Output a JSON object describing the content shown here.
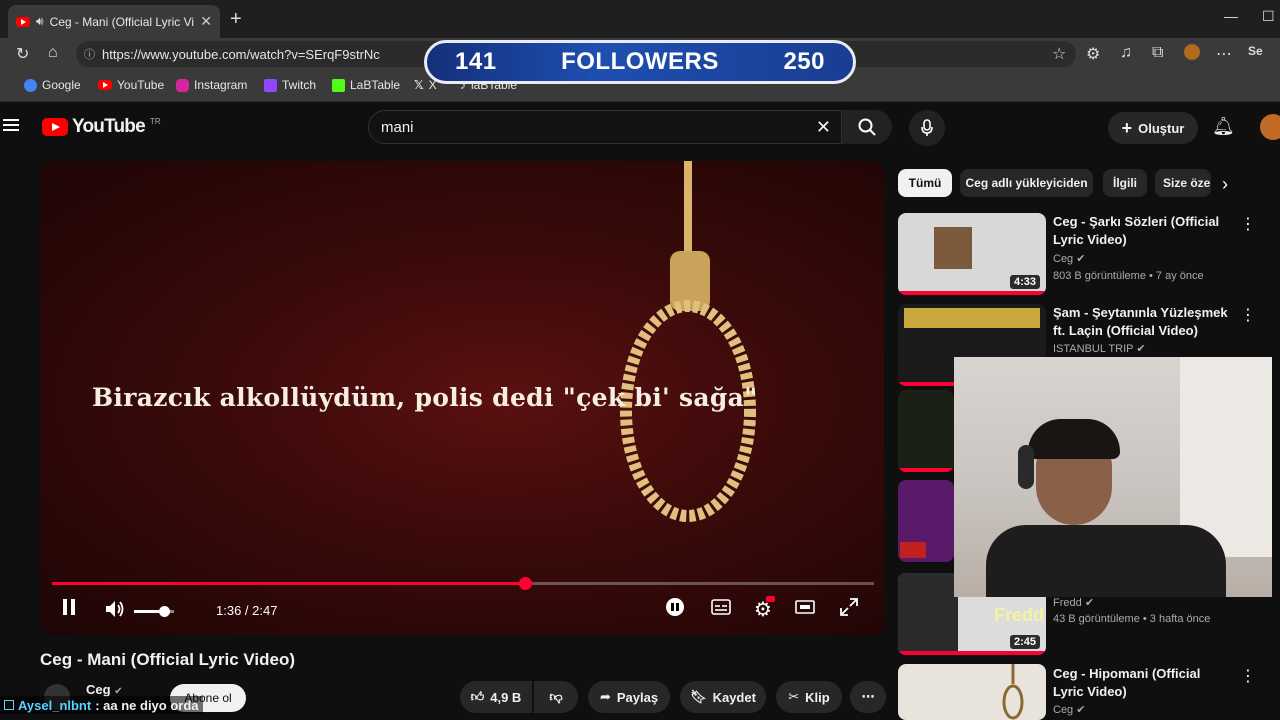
{
  "browser": {
    "tab_title": "Ceg - Mani (Official Lyric Video)",
    "new_tab": "+",
    "url": "https://www.youtube.com/watch?v=SErqF9strNc",
    "bookmarks": [
      "Google",
      "YouTube",
      "Instagram",
      "Twitch",
      "LaBTable",
      "X",
      "laBTable"
    ],
    "profile_label": "Se"
  },
  "overlay": {
    "followers_current": "141",
    "followers_label": "FOLLOWERS",
    "followers_goal": "250"
  },
  "yt": {
    "logo_text": "YouTube",
    "logo_region": "TR",
    "search_value": "mani",
    "create_label": "Oluştur"
  },
  "player": {
    "lyric": "Birazcık alkollüydüm, polis dedi \"çek bi' sağa\"",
    "time": "1:36 / 2:47",
    "progress_fraction": 0.575,
    "volume_fraction": 0.75
  },
  "video": {
    "title": "Ceg - Mani (Official Lyric Video)",
    "channel": "Ceg",
    "subscribe": "Abone ol",
    "likes": "4,9 B",
    "share": "Paylaş",
    "save": "Kaydet",
    "clip": "Klip"
  },
  "chat": {
    "user": "Aysel_nlbnt",
    "message": ": aa ne diyo orda"
  },
  "chips": [
    "Tümü",
    "Ceg adlı yükleyiciden",
    "İlgili",
    "Size özel"
  ],
  "recommendations": [
    {
      "title": "Ceg - Şarkı Sözleri (Official Lyric Video)",
      "channel": "Ceg",
      "meta": "803 B görüntüleme • 7 ay önce",
      "duration": "4:33"
    },
    {
      "title": "Şam - Şeytanınla Yüzleşmek ft. Laçin (Official Video)",
      "channel": "ISTANBUL TRIP",
      "meta": "",
      "duration": ""
    },
    {
      "title": "",
      "channel": "Fredd",
      "meta": "43 B görüntüleme • 3 hafta önce",
      "duration": "2:45"
    },
    {
      "title": "Ceg - Hipomani (Official Lyric Video)",
      "channel": "Ceg",
      "meta": "",
      "duration": ""
    }
  ],
  "colors": {
    "accent": "#ff0033",
    "background": "#0f0f0f",
    "chip_bg": "#272727",
    "followers_bg": "#1e4fb0"
  }
}
